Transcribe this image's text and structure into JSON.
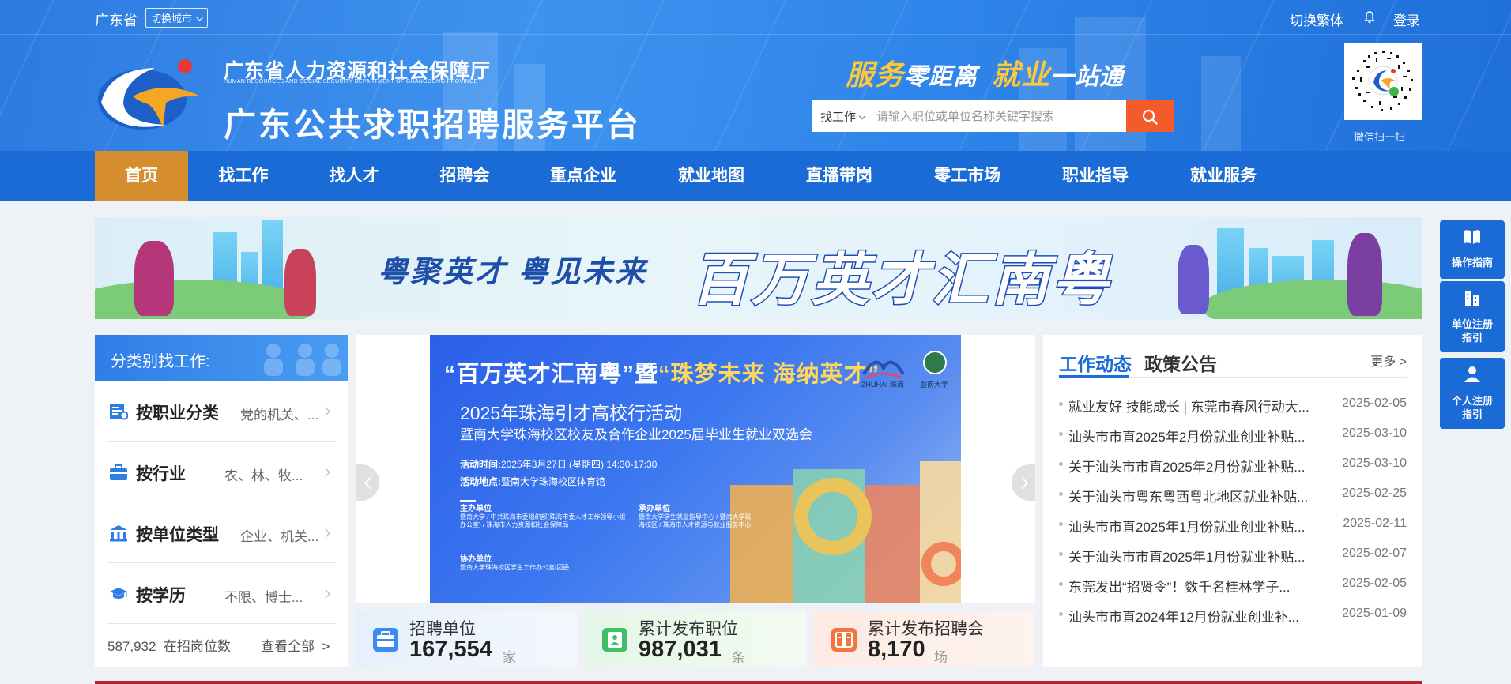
{
  "topbar": {
    "province": "广东省",
    "switch_city": "切换城市",
    "traditional": "切换繁体",
    "login": "登录"
  },
  "brand": {
    "dept_name": "广东省人力资源和社会保障厅",
    "dept_name_en": "HUMAN RESOURCES AND SOCIAL SECURITY DEPARTMENT OF GUANGDONG PROVINCE",
    "platform_name": "广东公共求职招聘服务平台"
  },
  "slogan": {
    "part1_highlight": "服务",
    "part1_rest": "零距离",
    "part2_highlight": "就业",
    "part2_rest": "一站通"
  },
  "search": {
    "type": "找工作",
    "placeholder": "请输入职位或单位名称关键字搜索",
    "value": ""
  },
  "qr": {
    "caption": "微信扫一扫"
  },
  "nav": [
    {
      "label": "首页",
      "active": true
    },
    {
      "label": "找工作"
    },
    {
      "label": "找人才"
    },
    {
      "label": "招聘会"
    },
    {
      "label": "重点企业"
    },
    {
      "label": "就业地图"
    },
    {
      "label": "直播带岗"
    },
    {
      "label": "零工市场"
    },
    {
      "label": "职业指导"
    },
    {
      "label": "就业服务"
    }
  ],
  "banner": {
    "subtitle": "粤聚英才 粤见未来",
    "title": "百万英才汇南粤"
  },
  "category": {
    "header": "分类别找工作:",
    "rows": [
      {
        "title": "按职业分类",
        "desc": "党的机关、..."
      },
      {
        "title": "按行业",
        "desc": "农、林、牧..."
      },
      {
        "title": "按单位类型",
        "desc": "企业、机关..."
      },
      {
        "title": "按学历",
        "desc": "不限、博士..."
      }
    ],
    "count_value": "587,932",
    "count_label": "在招岗位数",
    "view_all": "查看全部"
  },
  "slide": {
    "title_p1": "“百万英才汇南粤”暨",
    "title_p2": "“珠梦未来 海纳英才”",
    "logo1_text": "ZHUHAI 珠海",
    "logo2_text": "暨南大学",
    "heading1": "2025年珠海引才高校行活动",
    "heading2": "暨南大学珠海校区校友及合作企业2025届毕业生就业双选会",
    "time_label": "活动时间:",
    "time_value": "2025年3月27日 (星期四) 14:30-17:30",
    "place_label": "活动地点:",
    "place_value": "暨南大学珠海校区体育馆",
    "host_title": "主办单位",
    "host_lines": "暨南大学 / 中共珠海市委组织部(珠海市委人才工作领导小组办公室) / 珠海市人力资源和社会保障局",
    "organizer_title": "承办单位",
    "organizer_lines": "暨南大学学生就业指导中心 / 暨南大学珠海校区 / 珠海市人才资源与就业服务中心",
    "co_title": "协办单位",
    "co_lines": "暨南大学珠海校区学生工作办公室/团委",
    "dots_total": 7,
    "dots_active": 5
  },
  "stats": [
    {
      "label": "招聘单位",
      "value": "167,554",
      "unit": "家"
    },
    {
      "label": "累计发布职位",
      "value": "987,031",
      "unit": "条"
    },
    {
      "label": "累计发布招聘会",
      "value": "8,170",
      "unit": "场"
    }
  ],
  "news": {
    "tabs": [
      "工作动态",
      "政策公告"
    ],
    "more": "更多 >",
    "items": [
      {
        "title": "就业友好 技能成长 | 东莞市春风行动大...",
        "date": "2025-02-05"
      },
      {
        "title": "汕头市市直2025年2月份就业创业补贴...",
        "date": "2025-03-10"
      },
      {
        "title": "关于汕头市市直2025年2月份就业补贴...",
        "date": "2025-03-10"
      },
      {
        "title": "关于汕头市粤东粤西粤北地区就业补贴...",
        "date": "2025-02-25"
      },
      {
        "title": "汕头市市直2025年1月份就业创业补贴...",
        "date": "2025-02-11"
      },
      {
        "title": "关于汕头市市直2025年1月份就业补贴...",
        "date": "2025-02-07"
      },
      {
        "title": "东莞发出“招贤令”！数千名桂林学子...",
        "date": "2025-02-05"
      },
      {
        "title": "汕头市市直2024年12月份就业创业补...",
        "date": "2025-01-09"
      }
    ]
  },
  "side": [
    {
      "label1": "操作指南",
      "label2": ""
    },
    {
      "label1": "单位注册",
      "label2": "指引"
    },
    {
      "label1": "个人注册",
      "label2": "指引"
    }
  ],
  "colors": {
    "nav_blue": "#1a6bd6",
    "nav_active": "#d68d2d",
    "search_button": "#f55a2c",
    "slogan_gold": "#ffc73a"
  }
}
